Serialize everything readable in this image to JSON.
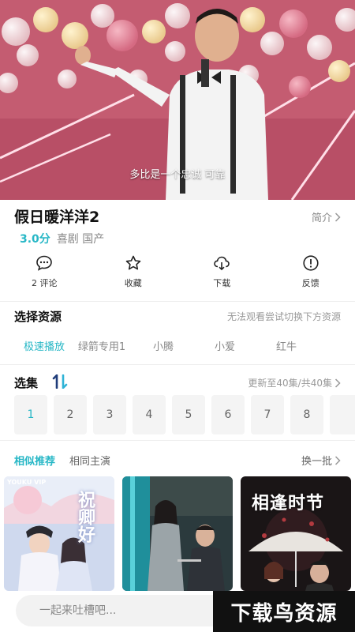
{
  "video": {
    "subtitle": "多比是一个忠诚 可靠"
  },
  "show": {
    "title": "假日暖洋洋2",
    "intro_label": "简介",
    "score": "3.0分",
    "tags": "喜剧 国产"
  },
  "actions": [
    {
      "label": "2 评论",
      "icon": "comment-icon"
    },
    {
      "label": "收藏",
      "icon": "star-icon"
    },
    {
      "label": "下载",
      "icon": "download-icon"
    },
    {
      "label": "反馈",
      "icon": "feedback-icon"
    }
  ],
  "resources": {
    "title": "选择资源",
    "hint": "无法观看尝试切换下方资源",
    "sources": [
      "极速播放",
      "绿箭专用1",
      "小腾",
      "小爱",
      "红牛"
    ],
    "active_source": "极速播放"
  },
  "episodes": {
    "title": "选集",
    "update_info": "更新至40集/共40集",
    "items": [
      "1",
      "2",
      "3",
      "4",
      "5",
      "6",
      "7",
      "8"
    ],
    "active": "1"
  },
  "recommend": {
    "tabs": [
      "相似推荐",
      "相同主演"
    ],
    "active_tab": "相似推荐",
    "refresh_label": "换一批",
    "posters": [
      {
        "badge": "YOUKU VIP",
        "title": "祝卿好"
      },
      {
        "badge": "",
        "title": ""
      },
      {
        "badge": "",
        "title": "相逢时节"
      }
    ]
  },
  "bottom": {
    "comment_placeholder": "一起来吐槽吧...",
    "watermark": "下载鸟资源"
  },
  "colors": {
    "accent": "#27b7c6",
    "video_bg": "#c85f74"
  }
}
